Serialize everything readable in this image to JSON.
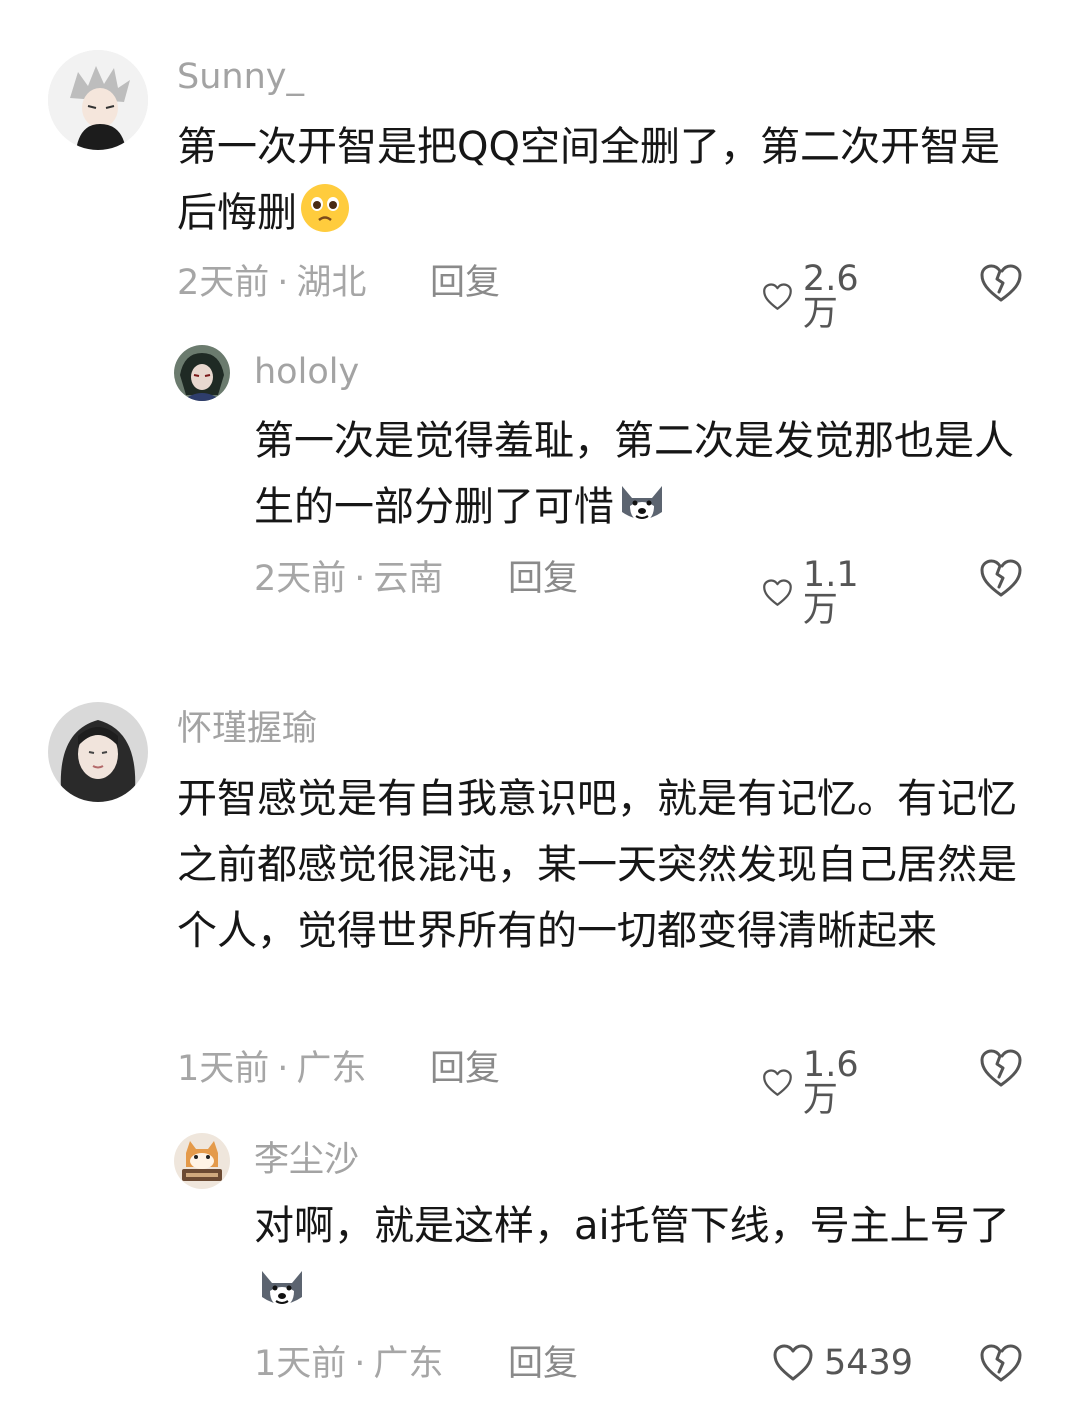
{
  "comments": [
    {
      "username": "Sunny_",
      "text": "第一次开智是把QQ空间全删了，第二次开智是后悔删",
      "emoji": "pleading-face-emoji",
      "time": "2天前",
      "location": "湖北",
      "reply_label": "回复",
      "likes": "2.6万",
      "avatar": "anime-boy-avatar"
    },
    {
      "username": "hololy",
      "text": "第一次是觉得羞耻，第二次是发觉那也是人生的一部分删了可惜",
      "emoji": "husky-dog-emoji",
      "time": "2天前",
      "location": "云南",
      "reply_label": "回复",
      "likes": "1.1万",
      "avatar": "anime-character-avatar"
    },
    {
      "username": "怀瑾握瑜",
      "text": "开智感觉是有自我意识吧，就是有记忆。有记忆之前都感觉很混沌，某一天突然发现自己居然是个人，觉得世界所有的一切都变得清晰起来",
      "emoji": "",
      "time": "1天前",
      "location": "广东",
      "reply_label": "回复",
      "likes": "1.6万",
      "avatar": "girl-photo-avatar"
    },
    {
      "username": "李尘沙",
      "text": "对啊，就是这样，ai托管下线，号主上号了",
      "emoji": "husky-dog-emoji",
      "time": "1天前",
      "location": "广东",
      "reply_label": "回复",
      "likes": "5439",
      "avatar": "cat-cartoon-avatar"
    }
  ],
  "separator": "·",
  "colors": {
    "meta_gray": "#a6a6a6",
    "text": "#161616",
    "username_gray": "#a3a3a3"
  }
}
